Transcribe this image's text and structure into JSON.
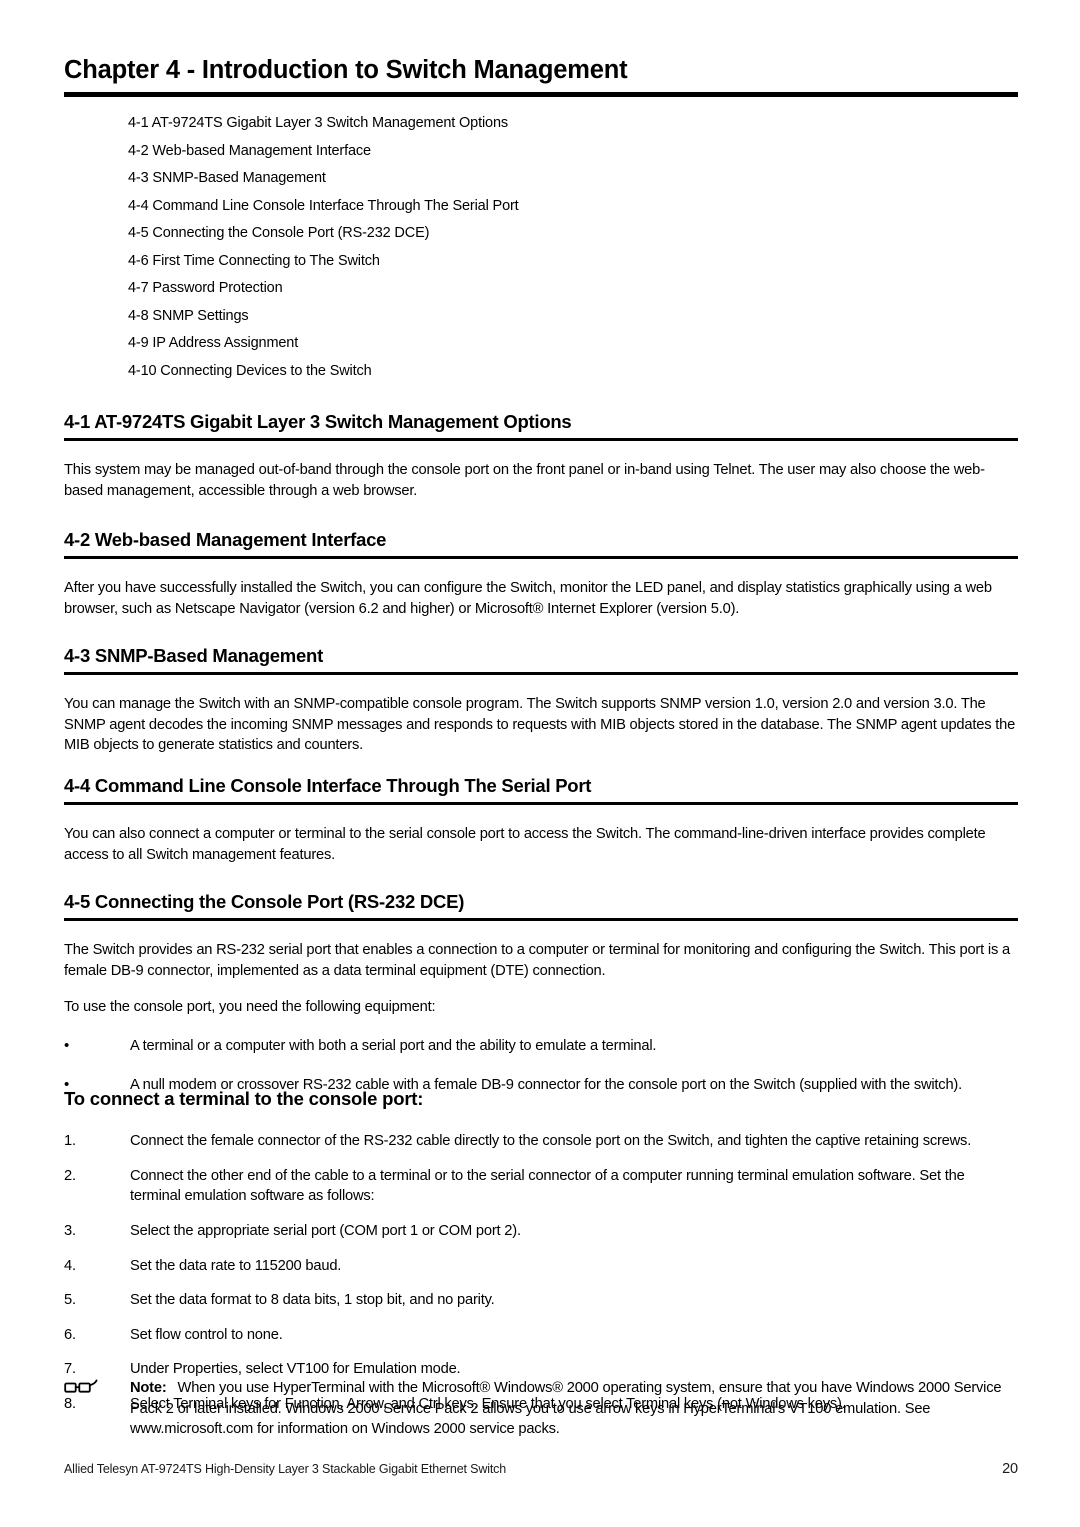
{
  "chapter": {
    "title": "Chapter 4 - Introduction to Switch Management"
  },
  "toc": {
    "items": [
      "4-1 AT-9724TS Gigabit Layer 3 Switch Management Options",
      "4-2 Web-based Management Interface",
      "4-3 SNMP-Based Management",
      "4-4 Command Line Console Interface Through The Serial Port",
      "4-5 Connecting the Console Port (RS-232 DCE)",
      "4-6 First Time Connecting to The Switch",
      "4-7 Password Protection",
      "4-8 SNMP Settings",
      "4-9 IP Address Assignment",
      "4-10 Connecting Devices to the Switch"
    ]
  },
  "sections": {
    "s41": {
      "heading": "4-1 AT-9724TS Gigabit Layer 3 Switch Management Options",
      "body": "This system may be managed out-of-band through the console port on the front panel or in-band using Telnet. The user may also choose the web-based management, accessible through a web browser."
    },
    "s42": {
      "heading": "4-2 Web-based Management Interface",
      "body": "After you have successfully installed the Switch, you can configure the Switch, monitor the LED panel, and display statistics graphically using a web browser, such as Netscape Navigator (version 6.2 and higher) or Microsoft® Internet Explorer (version 5.0)."
    },
    "s43": {
      "heading": "4-3 SNMP-Based Management",
      "body": "You can manage the Switch with an SNMP-compatible console program. The Switch supports SNMP version 1.0, version 2.0 and version 3.0. The SNMP agent decodes the incoming SNMP messages and responds to requests with MIB objects stored in the database. The SNMP agent updates the MIB objects to generate statistics and counters."
    },
    "s44": {
      "heading": "4-4 Command Line Console Interface Through The Serial Port",
      "body": "You can also connect a computer or terminal to the serial console port to access the Switch. The command-line-driven interface provides complete access to all Switch management features."
    },
    "s45": {
      "heading": "4-5 Connecting the Console Port (RS-232 DCE)",
      "body": "The Switch provides an RS-232 serial port that enables a connection to a computer or terminal for monitoring and configuring the Switch. This port is a female DB-9 connector, implemented as a data terminal equipment (DTE) connection.",
      "body2": "To use the console port, you need the following equipment:",
      "bullet_marker": "•",
      "bullets": [
        "A terminal or a computer with both a serial port and the ability to emulate a terminal.",
        "A null modem or crossover RS-232 cable with a female DB-9 connector for the console port on the Switch (supplied with the switch)."
      ]
    }
  },
  "procedure": {
    "heading": "To connect a terminal to the console port:",
    "steps": [
      {
        "marker": "1.",
        "text": "Connect the female connector of the RS-232 cable directly to the console port on the Switch, and tighten the captive retaining screws."
      },
      {
        "marker": "2.",
        "text": "Connect the other end of the cable to a terminal or to the serial connector of a computer running terminal emulation software. Set the terminal emulation software as follows:"
      },
      {
        "marker": "3.",
        "text": "Select the appropriate serial port (COM port 1 or COM port 2)."
      },
      {
        "marker": "4.",
        "text": "Set the data rate to 115200 baud."
      },
      {
        "marker": "5.",
        "text": "Set the data format to 8 data bits, 1 stop bit, and no parity."
      },
      {
        "marker": "6.",
        "text": "Set flow control to none."
      },
      {
        "marker": "7.",
        "text": "Under Properties, select VT100 for Emulation mode."
      },
      {
        "marker": "8.",
        "text": "Select Terminal keys for Function, Arrow, and Ctrl keys. Ensure that you select Terminal keys (not Windows keys)."
      }
    ]
  },
  "note": {
    "icon": "eyeglasses-icon",
    "label": "Note:",
    "text": "When you use HyperTerminal with the Microsoft® Windows® 2000 operating system, ensure that you have Windows 2000 Service Pack 2 or later installed. Windows 2000 Service Pack 2 allows you to use arrow keys in HyperTerminal's VT100 emulation. See www.microsoft.com for information on Windows 2000 service packs."
  },
  "footer": {
    "left": "Allied Telesyn AT-9724TS High-Density Layer 3 Stackable Gigabit Ethernet Switch",
    "page_number": "20"
  }
}
